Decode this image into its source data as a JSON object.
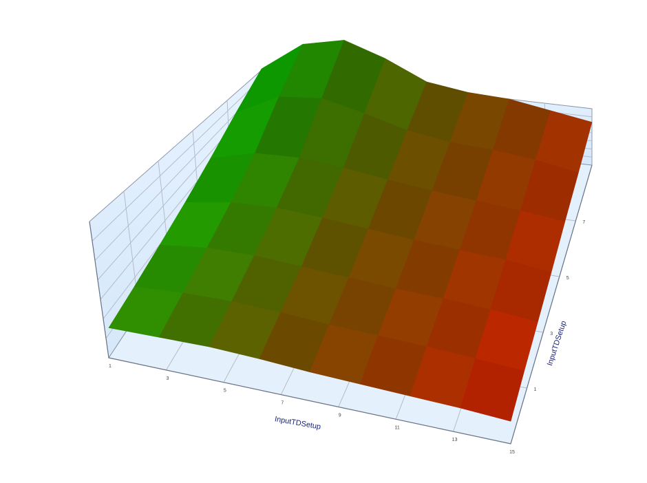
{
  "chart_data": {
    "type": "surface",
    "title": "",
    "xlabel": "InputTDSetup",
    "ylabel": "InputTDSetup",
    "zlabel": "",
    "x_ticks": [
      "1",
      "3",
      "5",
      "7",
      "9",
      "11",
      "13",
      "15"
    ],
    "y_ticks": [
      "1",
      "3",
      "5",
      "7"
    ],
    "grid": true,
    "colors": {
      "low": "#e02000",
      "mid": "#7a5a00",
      "high": "#00d000",
      "wall": "#ddeeff",
      "grid_line": "#b4bcc8"
    },
    "z_range": [
      0,
      10
    ],
    "surface_rows": [
      [
        6.0,
        9.0,
        9.9,
        8.5,
        6.6,
        6.0,
        5.8,
        5.1,
        4.4
      ],
      [
        5.2,
        7.3,
        7.7,
        6.8,
        5.7,
        5.1,
        4.9,
        4.5,
        3.8
      ],
      [
        4.3,
        5.4,
        5.6,
        5.3,
        4.8,
        4.4,
        4.1,
        3.8,
        3.4
      ],
      [
        3.6,
        4.3,
        4.5,
        4.3,
        4.0,
        3.7,
        3.5,
        3.3,
        2.9
      ],
      [
        3.1,
        3.6,
        3.7,
        3.5,
        3.3,
        3.1,
        3.0,
        2.8,
        2.5
      ],
      [
        2.7,
        3.0,
        3.1,
        3.0,
        2.8,
        2.7,
        2.6,
        2.4,
        2.2
      ],
      [
        2.4,
        2.5,
        2.6,
        2.5,
        2.3,
        2.2,
        2.1,
        2.0,
        1.8
      ]
    ]
  }
}
